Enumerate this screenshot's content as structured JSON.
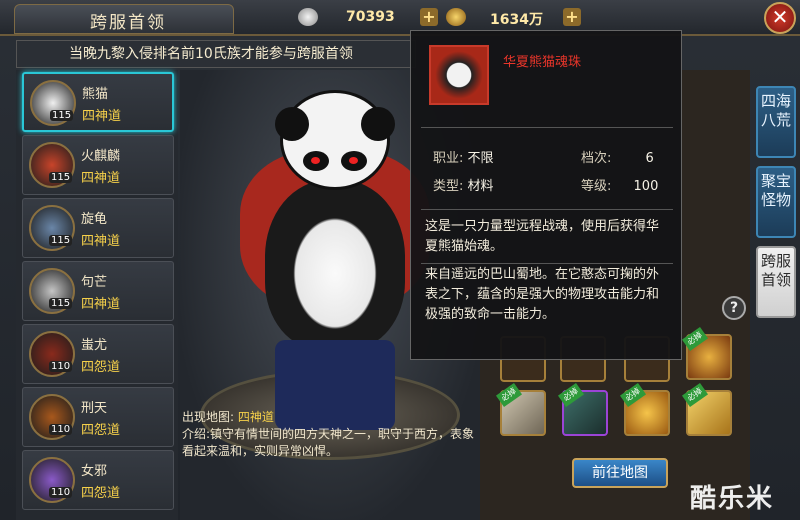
{
  "header": {
    "title": "跨服首领",
    "silver": "70393",
    "gold": "1634万"
  },
  "notice": "当晚九黎入侵排名前10氏族才能参与跨服首领",
  "bosses": [
    {
      "name": "熊猫",
      "type": "四神道",
      "level": "115",
      "selected": true
    },
    {
      "name": "火麒麟",
      "type": "四神道",
      "level": "115"
    },
    {
      "name": "旋龟",
      "type": "四神道",
      "level": "115"
    },
    {
      "name": "句芒",
      "type": "四神道",
      "level": "115"
    },
    {
      "name": "蚩尤",
      "type": "四怨道",
      "level": "110"
    },
    {
      "name": "刑天",
      "type": "四怨道",
      "level": "110"
    },
    {
      "name": "女邪",
      "type": "四怨道",
      "level": "110"
    }
  ],
  "stage": {
    "map_label": "出现地图:",
    "map_value": "四神道",
    "desc_label": "介绍:",
    "desc_text": "镇守有情世间的四方天神之一，职守于西方，表象看起来温和，实则异常凶悍。"
  },
  "tooltip": {
    "name": "华夏熊猫魂珠",
    "job_label": "职业:",
    "job_value": "不限",
    "grade_label": "档次:",
    "grade_value": "6",
    "type_label": "类型:",
    "type_value": "材料",
    "level_label": "等级:",
    "level_value": "100",
    "para1": "这是一只力量型远程战魂，使用后获得华夏熊猫始魂。",
    "para2": "来自遥远的巴山蜀地。在它憨态可掬的外表之下，蕴含的是强大的物理攻击能力和极强的致命一击能力。"
  },
  "drops": {
    "help": "?",
    "badge": "必掉",
    "go_button": "前往地图"
  },
  "side_tabs": [
    {
      "label": "四海八荒"
    },
    {
      "label": "聚宝怪物"
    },
    {
      "label": "跨服首领",
      "active": true
    }
  ],
  "watermark": "酷乐米",
  "colors": {
    "accent": "#2ac7d6",
    "gold_text": "#f5d04a",
    "item_name": "#e8352a"
  }
}
